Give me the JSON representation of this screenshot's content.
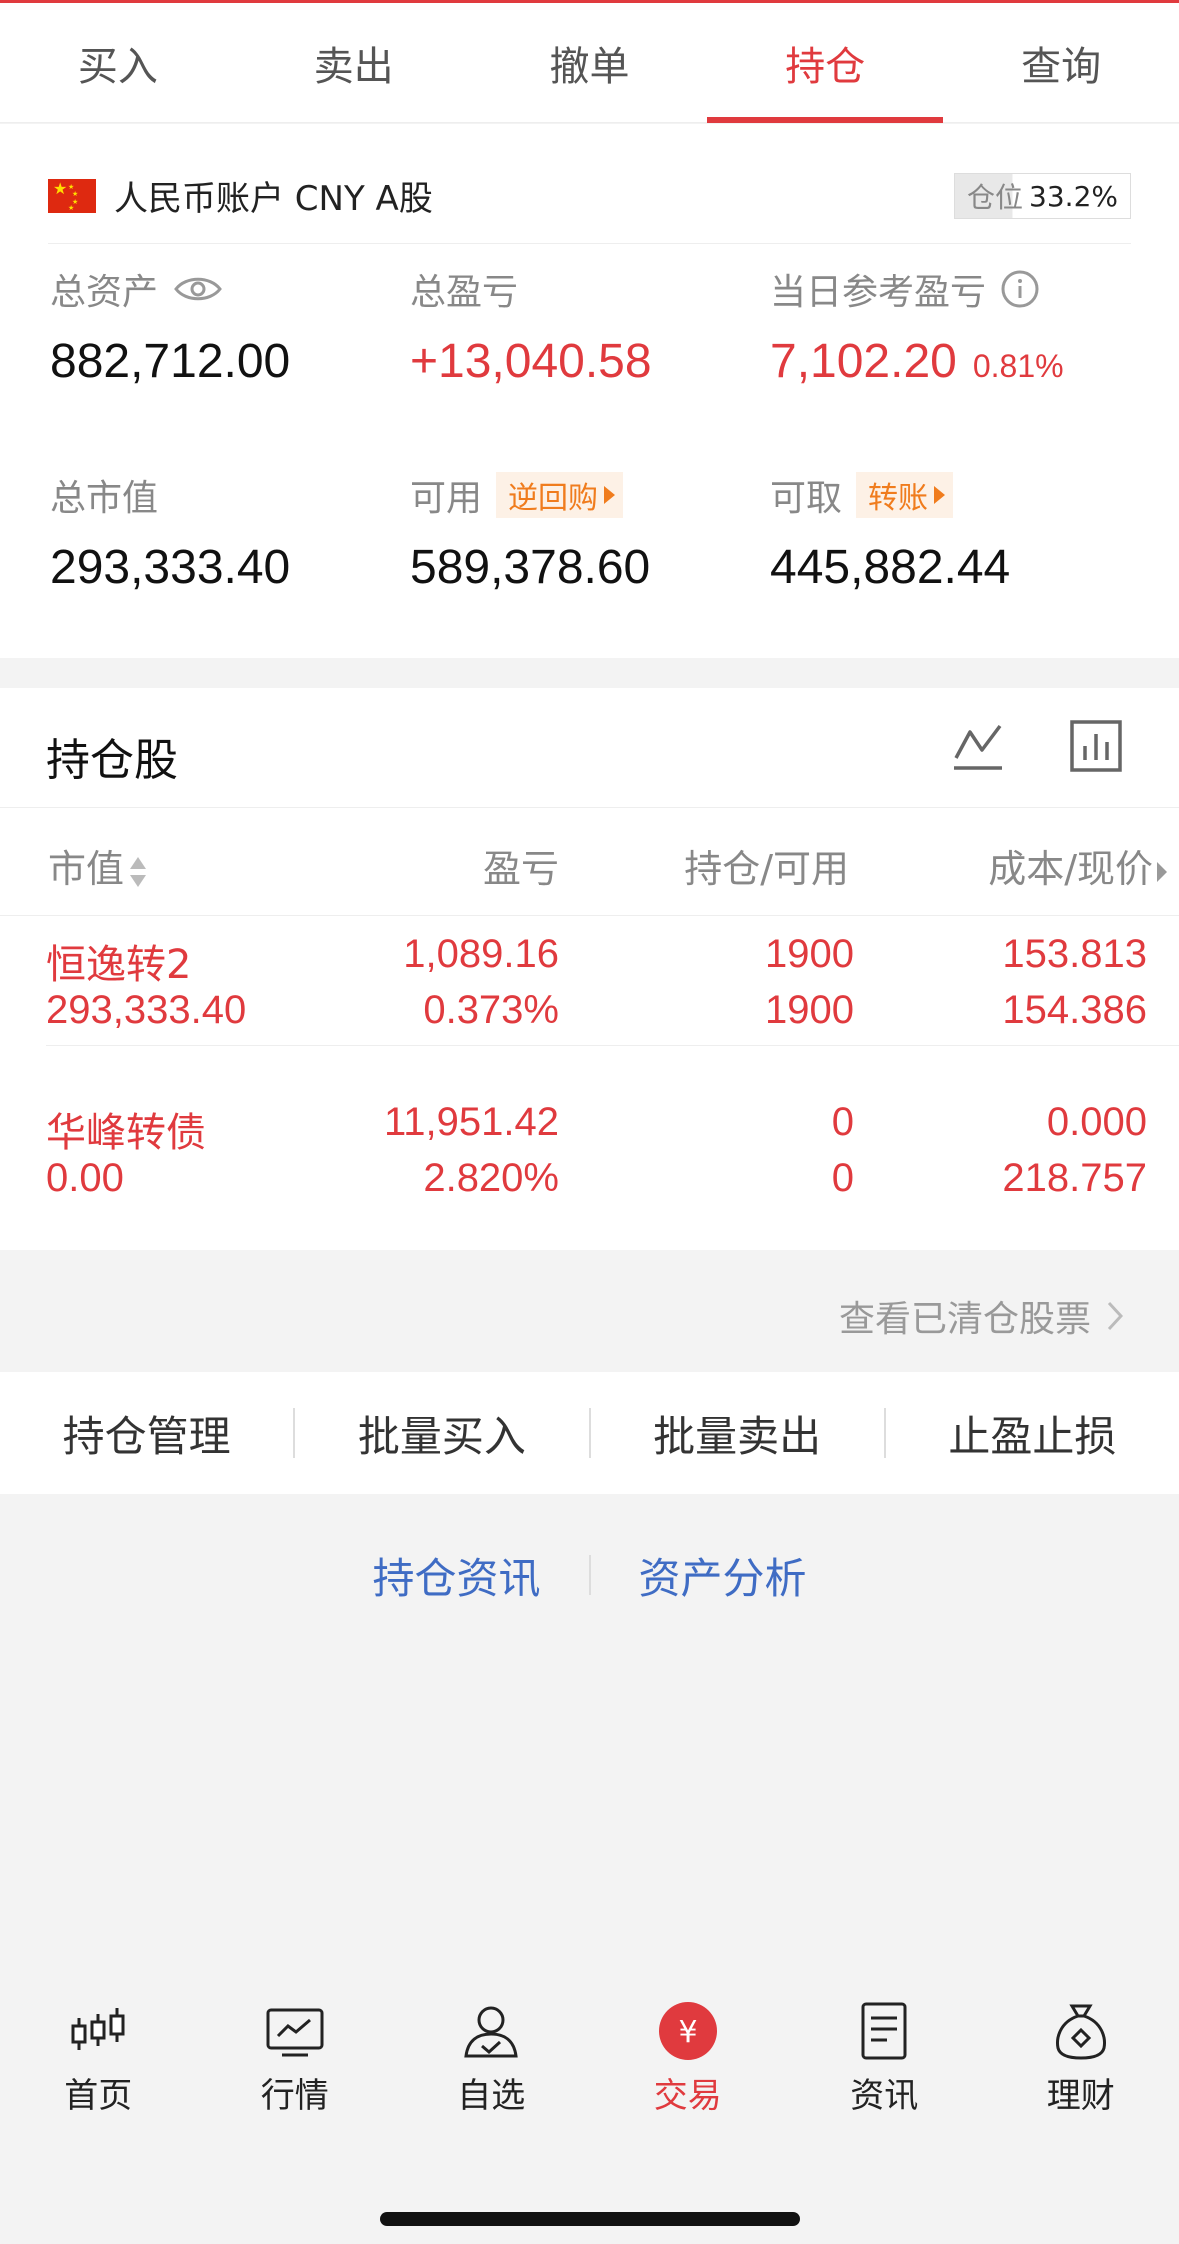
{
  "tabs": [
    {
      "label": "买入",
      "active": false
    },
    {
      "label": "卖出",
      "active": false
    },
    {
      "label": "撤单",
      "active": false
    },
    {
      "label": "持仓",
      "active": true
    },
    {
      "label": "查询",
      "active": false
    }
  ],
  "account": {
    "name": "人民币账户 CNY A股",
    "position_label": "仓位",
    "position_value": "33.2%",
    "position_fraction": 0.332,
    "total_assets_label": "总资产",
    "total_assets": "882,712.00",
    "total_pnl_label": "总盈亏",
    "total_pnl": "+13,040.58",
    "daily_pnl_label": "当日参考盈亏",
    "daily_pnl": "7,102.20",
    "daily_pnl_pct": "0.81%",
    "market_value_label": "总市值",
    "market_value": "293,333.40",
    "available_label": "可用",
    "available_tag": "逆回购",
    "available": "589,378.60",
    "withdrawable_label": "可取",
    "withdrawable_tag": "转账",
    "withdrawable": "445,882.44"
  },
  "holdings": {
    "title": "持仓股",
    "columns": {
      "market_value": "市值",
      "pnl": "盈亏",
      "position": "持仓/可用",
      "cost_price": "成本/现价"
    },
    "rows": [
      {
        "name": "恒逸转2",
        "market_value": "293,333.40",
        "pnl": "1,089.16",
        "pnl_pct": "0.373%",
        "position": "1900",
        "available": "1900",
        "cost": "153.813",
        "price": "154.386"
      },
      {
        "name": "华峰转债",
        "market_value": "0.00",
        "pnl": "11,951.42",
        "pnl_pct": "2.820%",
        "position": "0",
        "available": "0",
        "cost": "0.000",
        "price": "218.757"
      }
    ],
    "cleared_link": "查看已清仓股票"
  },
  "actions": [
    "持仓管理",
    "批量买入",
    "批量卖出",
    "止盈止损"
  ],
  "links": [
    "持仓资讯",
    "资产分析"
  ],
  "nav": [
    {
      "label": "首页",
      "icon": "candlestick-icon",
      "active": false
    },
    {
      "label": "行情",
      "icon": "chart-monitor-icon",
      "active": false
    },
    {
      "label": "自选",
      "icon": "person-check-icon",
      "active": false
    },
    {
      "label": "交易",
      "icon": "yuan-icon",
      "active": true
    },
    {
      "label": "资讯",
      "icon": "document-icon",
      "active": false
    },
    {
      "label": "理财",
      "icon": "money-bag-icon",
      "active": false
    }
  ],
  "colors": {
    "accent": "#e03a3e",
    "tag": "#f07c1d",
    "link": "#3f6cc4"
  }
}
